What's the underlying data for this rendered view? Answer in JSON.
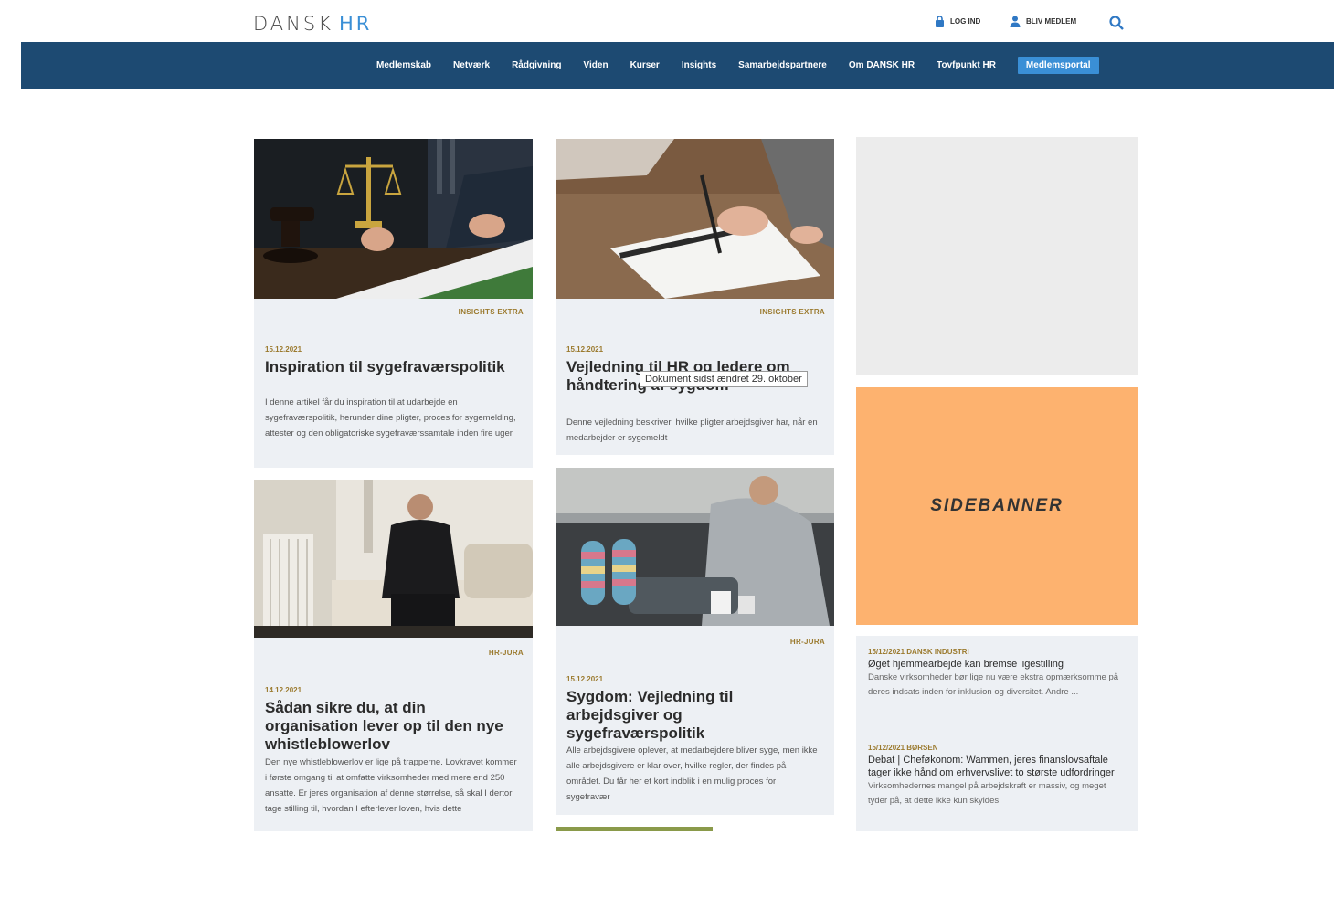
{
  "brand": {
    "part1": "DANSK",
    "part2": "HR"
  },
  "utility": {
    "login": "LOG IND",
    "member": "BLIV MEDLEM"
  },
  "nav": {
    "items": [
      "Medlemskab",
      "Netværk",
      "Rådgivning",
      "Viden",
      "Kurser",
      "Insights",
      "Samarbejdspartnere",
      "Om DANSK HR",
      "Tovfpunkt HR"
    ],
    "active": "Medlemsportal"
  },
  "articles": [
    {
      "tag": "INSIGHTS EXTRA",
      "date": "15.12.2021",
      "title": "Inspiration til sygefraværspolitik",
      "teaser": "I denne artikel får du inspiration til at udarbejde en sygefraværspolitik, herunder dine pligter, proces for sygemelding, attester og den obligatoriske sygefraværssamtale inden fire uger"
    },
    {
      "tag": "INSIGHTS EXTRA",
      "date": "15.12.2021",
      "title": "Vejledning til HR og ledere om håndtering af sygdom",
      "teaser": "Denne vejledning beskriver, hvilke pligter arbejdsgiver har, når en medarbejder er sygemeldt"
    },
    {
      "tag": "HR-JURA",
      "date": "14.12.2021",
      "title": "Sådan sikre du, at din organisation lever op til den nye whistleblowerlov",
      "teaser": "Den nye whistleblowerlov er lige på trapperne. Lovkravet kommer i første omgang til at omfatte virksomheder med mere end 250 ansatte. Er jeres organisation af denne størrelse, så skal I dertor tage stilling til, hvordan I efterlever loven, hvis dette"
    },
    {
      "tag": "HR-JURA",
      "date": "15.12.2021",
      "title": "Sygdom: Vejledning til arbejdsgiver og sygefraværspolitik",
      "teaser": "Alle arbejdsgivere oplever, at medarbejdere bliver syge, men ikke alle arbejdsgivere er klar over, hvilke regler, der findes på området. Du får her et kort indblik i en mulig proces for sygefravær"
    }
  ],
  "tooltip": "Dokument sidst ændret 29. oktober",
  "sidebanner": "SIDEBANNER",
  "news": [
    {
      "meta": "15/12/2021 DANSK INDUSTRI",
      "headline": "Øget hjemmearbejde kan bremse ligestilling",
      "text": "Danske virksomheder bør lige nu være ekstra opmærksomme på deres indsats inden for inklusion og diversitet. Andre ..."
    },
    {
      "meta": "15/12/2021 BØRSEN",
      "headline": "Debat | Cheføkonom: Wammen, jeres finanslovsaftale tager ikke hånd om erhvervslivet to største udfordringer",
      "text": "Virksomhedernes mangel på arbejdskraft er massiv, og meget tyder på, at dette ikke kun skyldes"
    }
  ],
  "colors": {
    "navbar": "#1d4a72",
    "accent": "#3a8fd6",
    "tag": "#9b7a2e",
    "sidebanner": "#fdb26f",
    "card": "#edf0f4"
  }
}
